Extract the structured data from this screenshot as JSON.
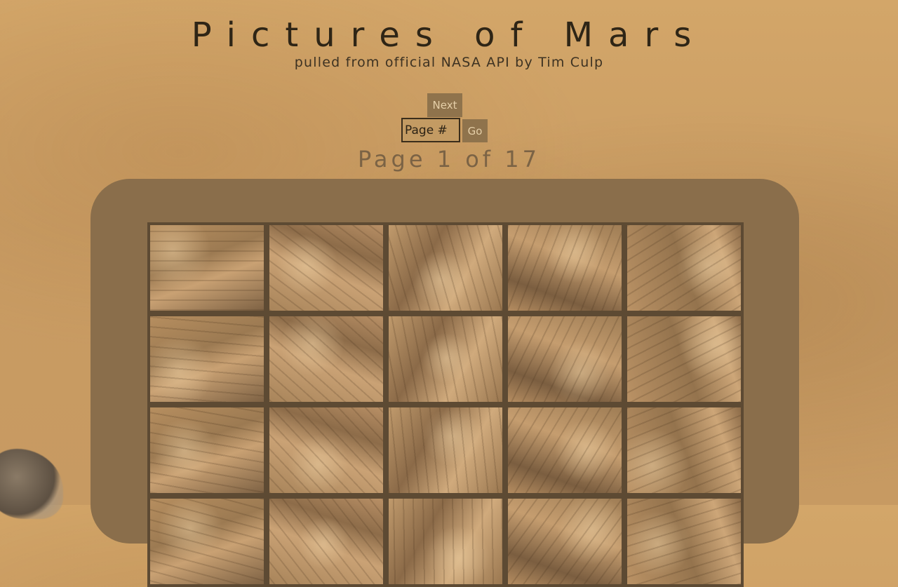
{
  "header": {
    "title": "Pictures of Mars",
    "subtitle": "pulled from official NASA API by Tim Culp"
  },
  "pagination": {
    "next_label": "Next",
    "page_placeholder": "Page #",
    "go_label": "Go",
    "page_label": "Page 1 of 17"
  },
  "colors": {
    "background": "#c99c63",
    "panel": "#8a6e4b",
    "button": "#8f734c",
    "tile_border": "#5d4a33",
    "title": "#2e2516"
  },
  "gallery": {
    "columns": 5,
    "visible_rows": 4,
    "tiles": [
      {
        "name": "mars-rover-photo"
      },
      {
        "name": "mars-rover-photo"
      },
      {
        "name": "mars-rover-photo"
      },
      {
        "name": "mars-rover-photo"
      },
      {
        "name": "mars-rover-photo"
      },
      {
        "name": "mars-rover-photo"
      },
      {
        "name": "mars-rover-photo"
      },
      {
        "name": "mars-rover-photo"
      },
      {
        "name": "mars-rover-photo"
      },
      {
        "name": "mars-rover-photo"
      },
      {
        "name": "mars-rover-photo"
      },
      {
        "name": "mars-rover-photo"
      },
      {
        "name": "mars-rover-photo"
      },
      {
        "name": "mars-rover-photo"
      },
      {
        "name": "mars-rover-photo"
      },
      {
        "name": "mars-rover-photo"
      },
      {
        "name": "mars-rover-photo"
      },
      {
        "name": "mars-rover-photo"
      },
      {
        "name": "mars-rover-photo"
      },
      {
        "name": "mars-rover-photo"
      }
    ]
  }
}
